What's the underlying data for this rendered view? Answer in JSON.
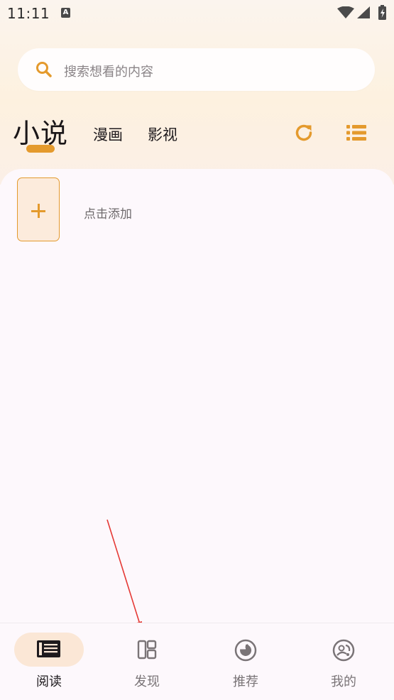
{
  "status_bar": {
    "time": "11:11",
    "notification_icon": "A"
  },
  "search": {
    "placeholder": "搜索想看的内容"
  },
  "tabs": [
    {
      "label": "小说",
      "selected": true
    },
    {
      "label": "漫画",
      "selected": false
    },
    {
      "label": "影视",
      "selected": false
    }
  ],
  "actions": {
    "refresh_icon": "refresh-icon",
    "list_icon": "list-view-icon"
  },
  "bookshelf": {
    "add_label": "点击添加"
  },
  "bottom_nav": [
    {
      "label": "阅读",
      "icon": "book-icon",
      "active": true
    },
    {
      "label": "发现",
      "icon": "layout-icon",
      "active": false
    },
    {
      "label": "推荐",
      "icon": "recommend-icon",
      "active": false
    },
    {
      "label": "我的",
      "icon": "profile-icon",
      "active": false
    }
  ],
  "colors": {
    "accent": "#e49a2d",
    "annotation": "#e53935",
    "active_pill": "#fbe7d6"
  }
}
